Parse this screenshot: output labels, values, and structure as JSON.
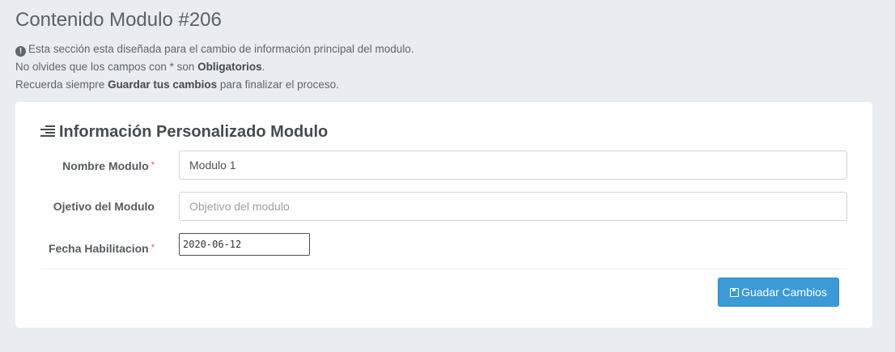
{
  "header": {
    "title": "Contenido Modulo #206"
  },
  "notes": {
    "line1": "Esta sección esta diseñada para el cambio de información principal del modulo.",
    "line2_pre": "No olvides que los campos con * son ",
    "line2_bold": "Obligatorios",
    "line2_post": ".",
    "line3_pre": "Recuerda siempre ",
    "line3_bold": "Guardar tus cambios",
    "line3_post": " para finalizar el proceso.",
    "info_icon": "info-circle-icon"
  },
  "card": {
    "title": "Información Personalizado Modulo",
    "title_icon": "list-icon"
  },
  "form": {
    "nombre": {
      "label": "Nombre Modulo",
      "required_mark": "*",
      "value": "Modulo 1",
      "placeholder": ""
    },
    "objetivo": {
      "label": "Ojetivo del Modulo",
      "value": "",
      "placeholder": "Objetivo del modulo"
    },
    "fecha": {
      "label": "Fecha Habilitacion",
      "required_mark": "*",
      "value": "2020-06-12"
    }
  },
  "actions": {
    "save_label": "Guadar Cambios",
    "save_icon": "floppy-disk-icon",
    "save_color": "#3c9ad6"
  }
}
